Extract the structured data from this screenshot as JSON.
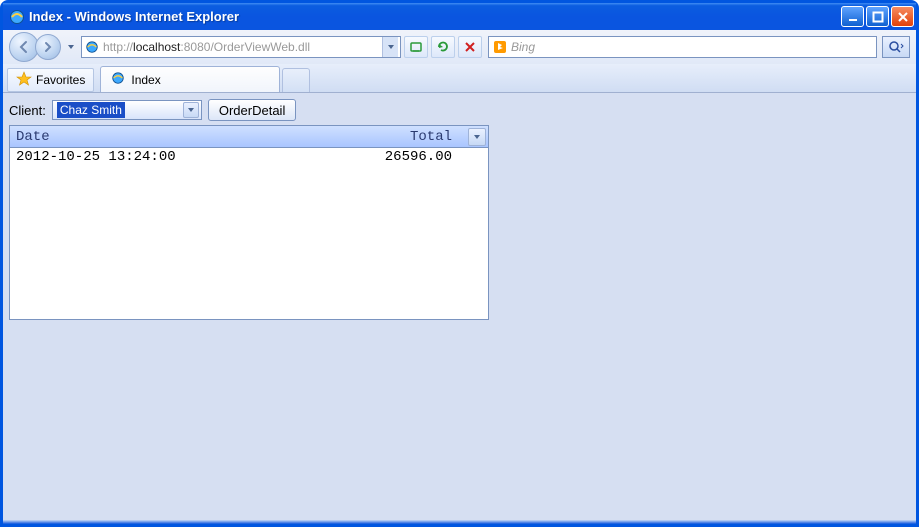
{
  "window": {
    "title": "Index - Windows Internet Explorer"
  },
  "address": {
    "prefix": "http://",
    "host": "localhost",
    "port": ":8080",
    "path": "/OrderViewWeb.dll"
  },
  "search": {
    "provider": "Bing"
  },
  "favorites_label": "Favorites",
  "tab": {
    "label": "Index"
  },
  "form": {
    "client_label": "Client:",
    "client_value": "Chaz Smith",
    "order_button": "OrderDetail"
  },
  "grid": {
    "columns": {
      "date": "Date",
      "total": "Total"
    },
    "rows": [
      {
        "date": "2012-10-25 13:24:00",
        "total": "26596.00"
      }
    ]
  }
}
